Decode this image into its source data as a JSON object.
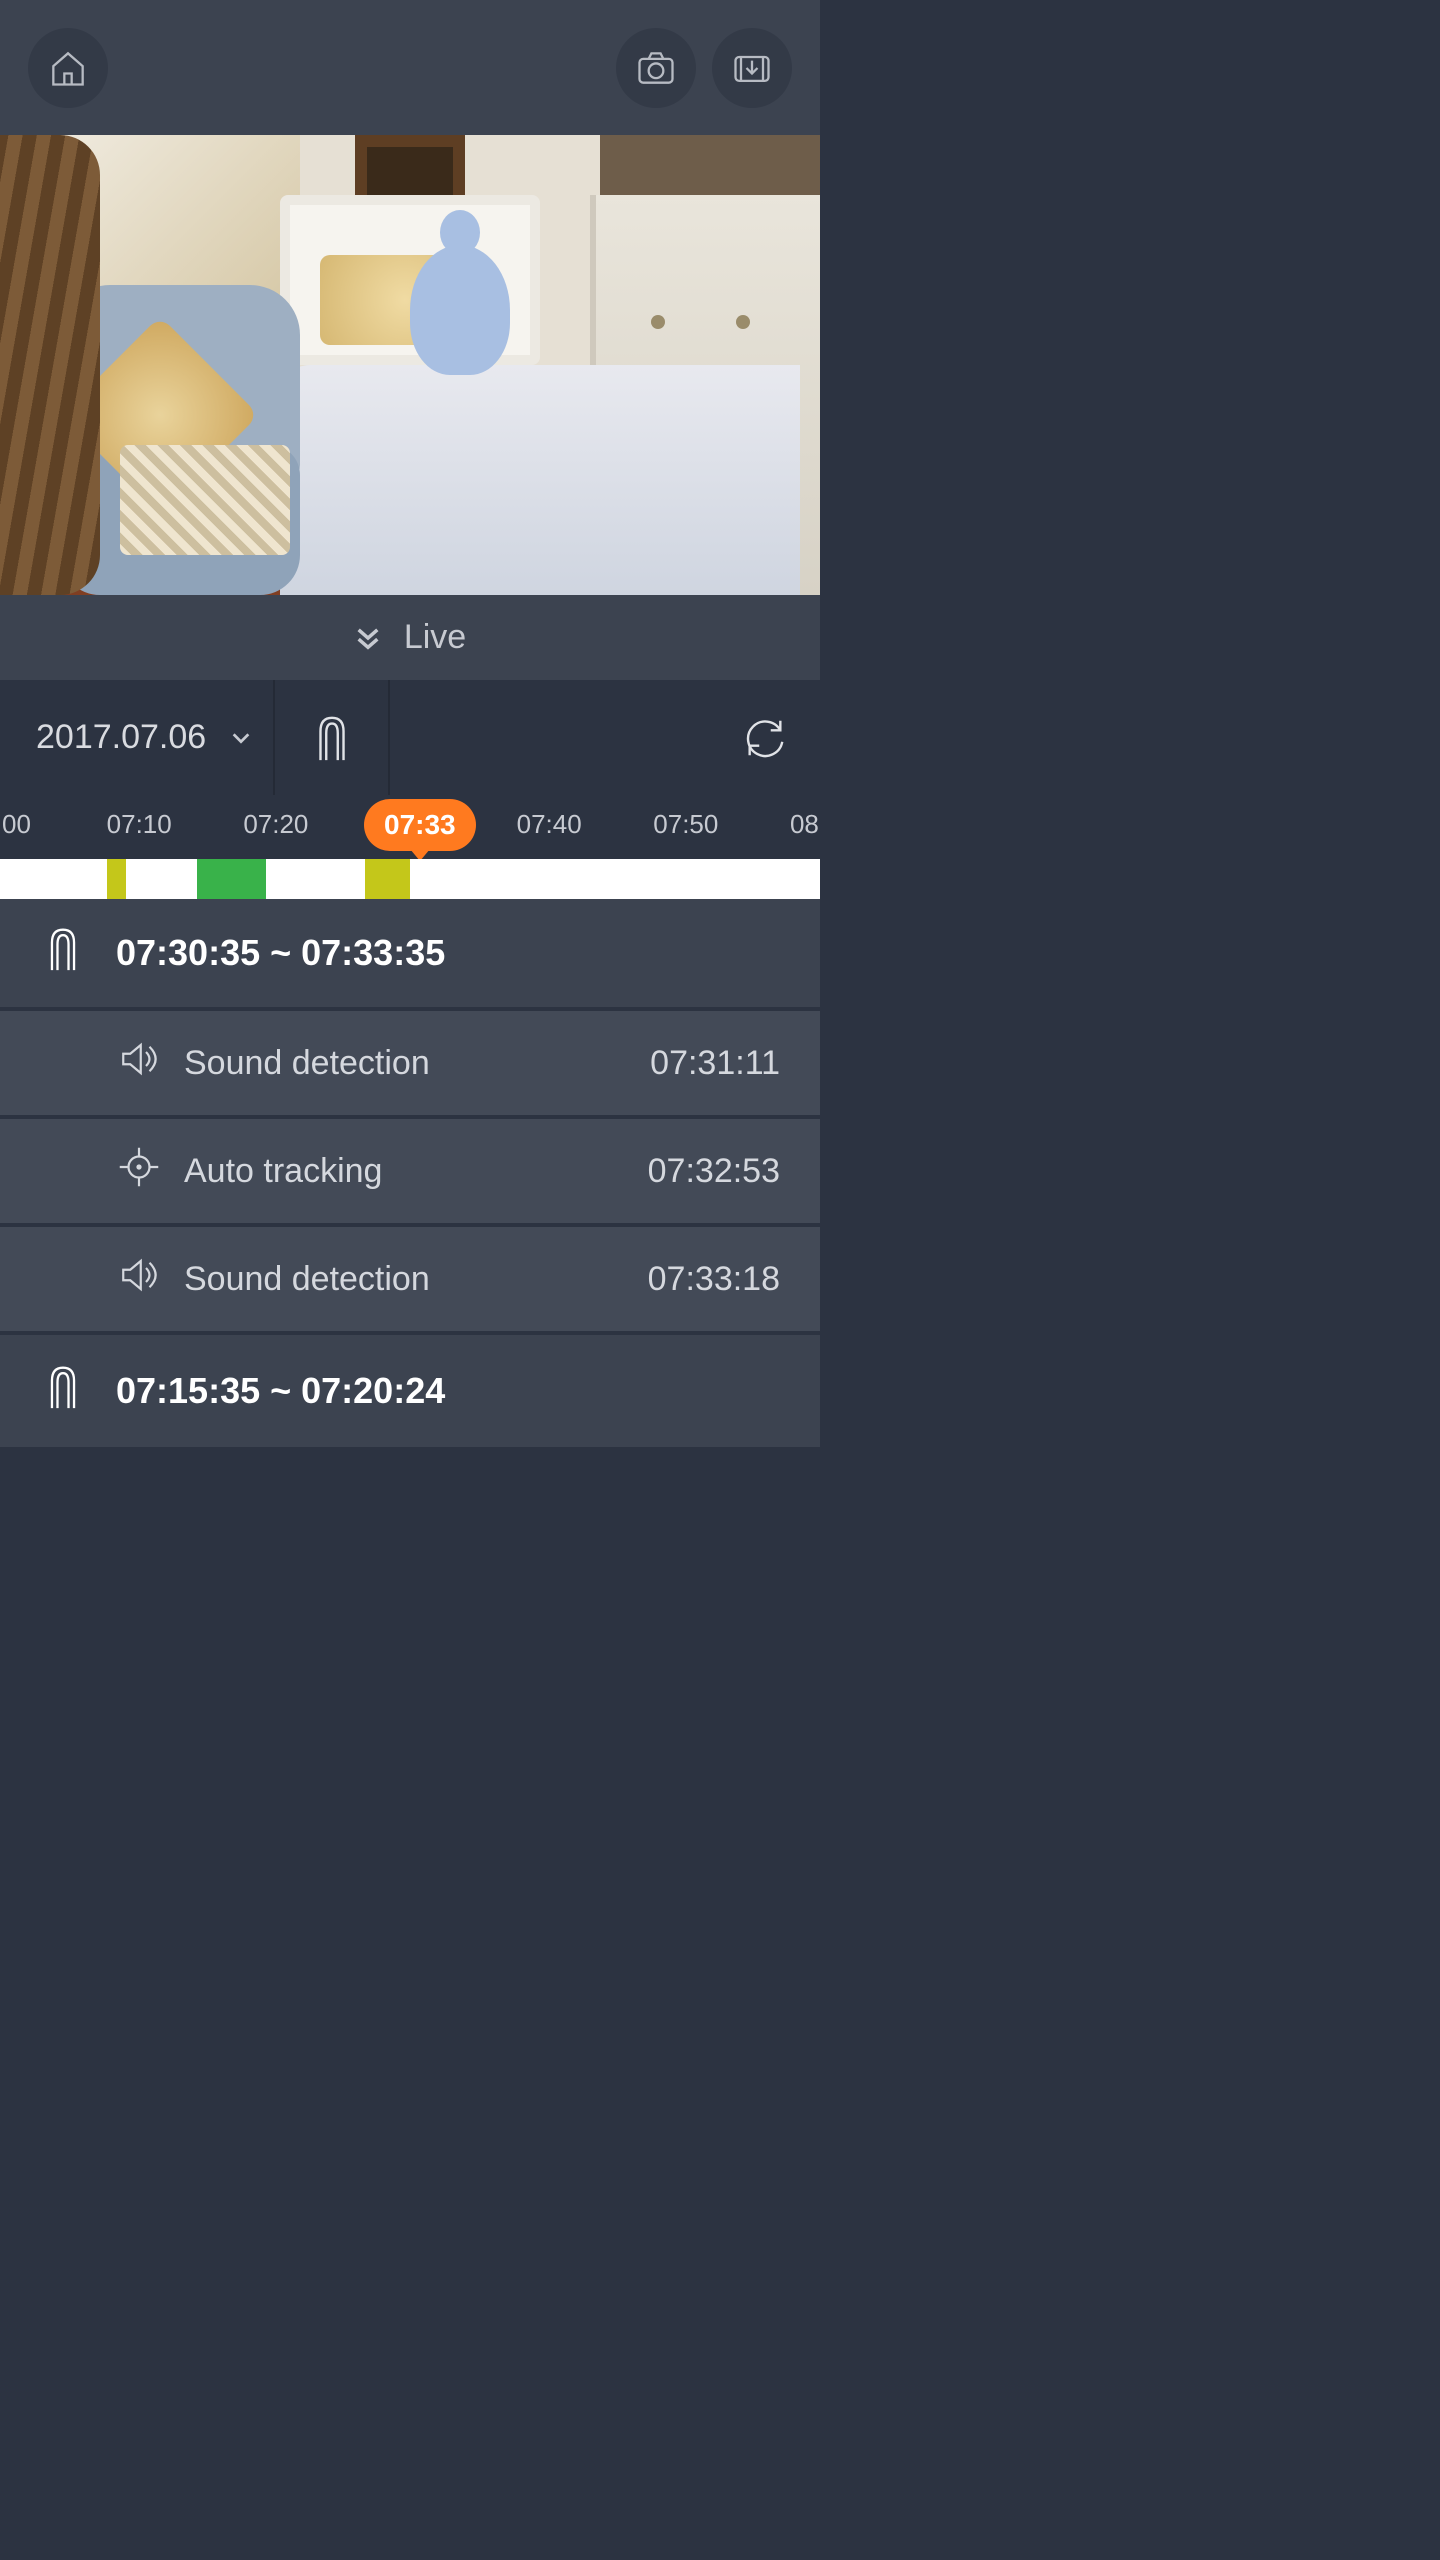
{
  "header": {},
  "live_label": "Live",
  "date": "2017.07.06",
  "timeline": {
    "ticks": [
      "00",
      "07:10",
      "07:20",
      "",
      "07:40",
      "07:50",
      "08"
    ],
    "current": "07:33",
    "segments": [
      {
        "color": "yellow",
        "left_pct": 13.0,
        "width_pct": 2.4
      },
      {
        "color": "green",
        "left_pct": 24.0,
        "width_pct": 8.5
      },
      {
        "color": "yellow",
        "left_pct": 44.5,
        "width_pct": 5.5
      }
    ]
  },
  "groups": [
    {
      "range": "07:30:35 ~ 07:33:35",
      "events": [
        {
          "icon": "sound",
          "label": "Sound detection",
          "time": "07:31:11"
        },
        {
          "icon": "target",
          "label": "Auto tracking",
          "time": "07:32:53"
        },
        {
          "icon": "sound",
          "label": "Sound detection",
          "time": "07:33:18"
        }
      ]
    },
    {
      "range": "07:15:35 ~ 07:20:24",
      "events": []
    }
  ]
}
